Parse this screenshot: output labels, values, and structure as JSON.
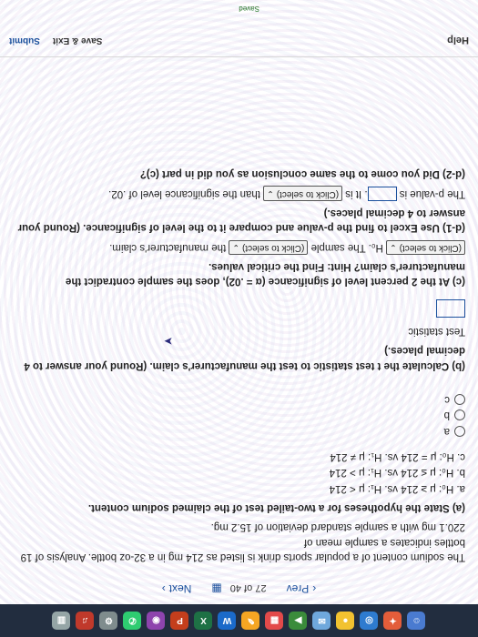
{
  "status": {
    "saved": "Saved"
  },
  "toolbar": {
    "help": "Help",
    "save_exit": "Save & Exit",
    "submit": "Submit"
  },
  "question": {
    "intro_line1": "The sodium content of a popular sports drink is listed as 214 mg in a 32-oz bottle. Analysis of 19 bottles indicates a sample mean of",
    "intro_line2": "220.1 mg with a sample standard deviation of 15.2 mg.",
    "part_a": "(a) State the hypotheses for a two-tailed test of the claimed sodium content.",
    "hyp_options": [
      "a. H₀: μ ≥ 214 vs. H₁: μ < 214",
      "b. H₀: μ ≤ 214 vs. H₁: μ > 214",
      "c. H₀: μ = 214 vs. H₁: μ ≠ 214"
    ],
    "radio_labels": [
      "a",
      "b",
      "c"
    ],
    "part_b": "(b) Calculate the t test statistic to test the manufacturer's claim.",
    "part_b_note": "(Round your answer to 4 decimal places.)",
    "test_stat_label": "Test statistic",
    "part_c": "(c) At the 2 percent level of significance (α = .02), does the sample contradict the manufacturer's claim? Hint: Find the critical values.",
    "select_label": "(Click to select)",
    "part_c_mid": "H₀. The sample",
    "part_c_end": "the manufacturer's claim.",
    "part_d1": "(d-1) Use Excel to find the p-value and compare it to the level of significance.",
    "part_d1_note": "(Round your answer to 4 decimal places.)",
    "pvalue_prefix": "The p-value is",
    "pvalue_mid": ". It is",
    "pvalue_end": "than the significance level of .02.",
    "part_d2": "(d-2) Did you come to the same conclusion as you did in part (c)?"
  },
  "nav": {
    "prev": "Prev",
    "page_current": "27",
    "page_of": "of",
    "page_total": "40",
    "next": "Next"
  },
  "icons": {
    "prev": "chevron-left-icon",
    "next": "chevron-right-icon",
    "grid": "grid-icon",
    "dropdown": "chevron-down-icon"
  },
  "colors": {
    "link": "#1a4f9c",
    "dock": "#222d3f"
  }
}
